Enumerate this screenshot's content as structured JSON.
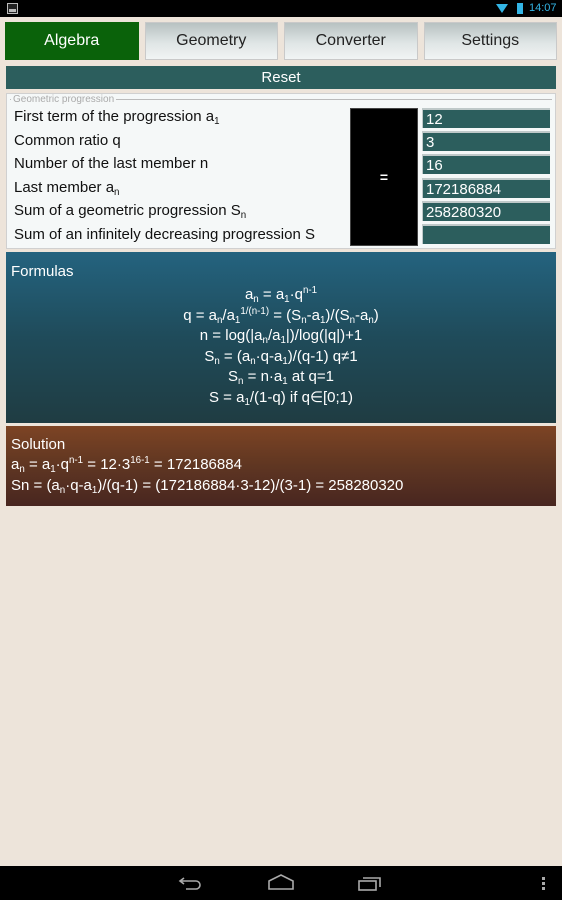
{
  "status_bar": {
    "time": "14:07",
    "icons": [
      "image-notification-icon",
      "wifi-icon",
      "battery-icon"
    ]
  },
  "tabs": [
    {
      "label": "Algebra",
      "active": true
    },
    {
      "label": "Geometry",
      "active": false
    },
    {
      "label": "Converter",
      "active": false
    },
    {
      "label": "Settings",
      "active": false
    }
  ],
  "reset_label": "Reset",
  "progression": {
    "legend": "Geometric progression",
    "fields": [
      {
        "label": "First term of the progression a",
        "sub": "1",
        "value": "12"
      },
      {
        "label": "Common ratio q",
        "sub": "",
        "value": "3"
      },
      {
        "label": "Number of the last member n",
        "sub": "",
        "value": "16"
      },
      {
        "label": "Last member a",
        "sub": "n",
        "value": "172186884"
      },
      {
        "label": "Sum of a geometric progression S",
        "sub": "n",
        "value": "258280320"
      },
      {
        "label": "Sum of an infinitely decreasing progression S",
        "sub": "",
        "value": ""
      }
    ],
    "calculate_label": "="
  },
  "formulas": {
    "title": "Formulas",
    "lines_html": [
      "a<sub>n</sub> = a<sub>1</sub>·q<sup>n-1</sup>",
      "q = a<sub>n</sub>/a<sub>1</sub><sup>1/(n-1)</sup> = (S<sub>n</sub>-a<sub>1</sub>)/(S<sub>n</sub>-a<sub>n</sub>)",
      "n = log(|a<sub>n</sub>/a<sub>1</sub>|)/log(|q|)+1",
      "S<sub>n</sub> = (a<sub>n</sub>·q-a<sub>1</sub>)/(q-1) q≠1",
      "S<sub>n</sub> = n·a<sub>1</sub> at q=1",
      "S = a<sub>1</sub>/(1-q) if q∈[0;1)"
    ]
  },
  "solution": {
    "title": "Solution",
    "line1_html": "a<sub>n</sub> = a<sub>1</sub>·q<sup>n-1</sup> = 12·3<sup>16-1</sup> = 172186884",
    "line2_html": "Sn = (a<sub>n</sub>·q-a<sub>1</sub>)/(q-1) = (172186884·3-12)/(3-1) = 258280320"
  },
  "nav_bar": {
    "buttons": [
      "back-icon",
      "home-icon",
      "recent-apps-icon",
      "menu-icon"
    ]
  },
  "colors": {
    "active_tab": "#0a620a",
    "teal": "#2c5e5d",
    "formulas_bg": "#1f4b5a",
    "solution_bg": "#5f3622",
    "background": "#ede4da"
  }
}
